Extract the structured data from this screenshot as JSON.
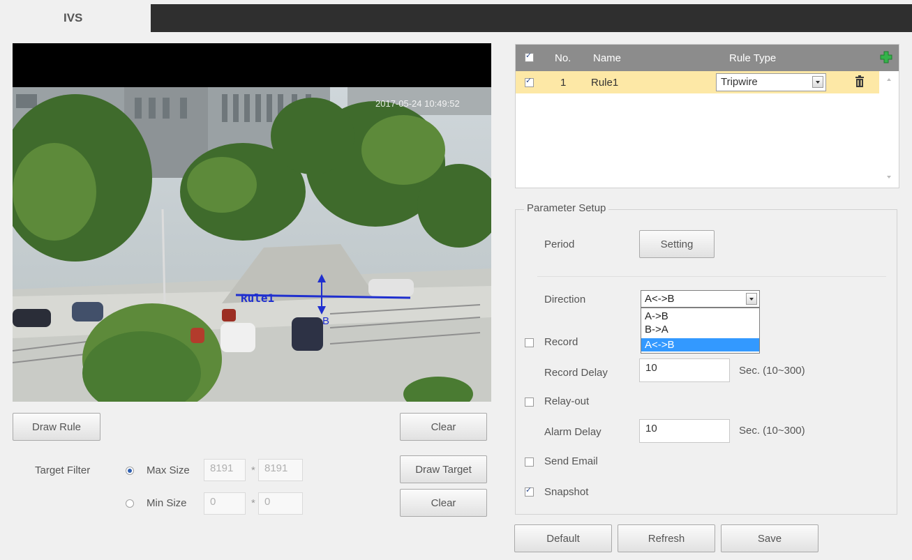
{
  "tab": {
    "label": "IVS"
  },
  "video": {
    "timestamp": "2017-05-24 10:49:52",
    "rule_label": "Rule1",
    "point_b": "B"
  },
  "left_controls": {
    "draw_rule": "Draw Rule",
    "clear1": "Clear",
    "target_filter_label": "Target Filter",
    "max_size_label": "Max Size",
    "max_w": "8191",
    "max_h": "8191",
    "min_size_label": "Min Size",
    "min_w": "0",
    "min_h": "0",
    "times": "*",
    "draw_target": "Draw Target",
    "clear2": "Clear"
  },
  "rule_table": {
    "headers": {
      "no": "No.",
      "name": "Name",
      "rule_type": "Rule Type"
    },
    "rows": [
      {
        "no": "1",
        "name": "Rule1",
        "rule_type": "Tripwire"
      }
    ]
  },
  "param": {
    "legend": "Parameter Setup",
    "period_label": "Period",
    "setting_button": "Setting",
    "direction_label": "Direction",
    "direction_value": "A<->B",
    "direction_options": [
      "A->B",
      "B->A",
      "A<->B"
    ],
    "record_label": "Record",
    "record_delay_label": "Record Delay",
    "record_delay_value": "10",
    "record_delay_unit": "Sec. (10~300)",
    "relay_out_label": "Relay-out",
    "alarm_delay_label": "Alarm Delay",
    "alarm_delay_value": "10",
    "alarm_delay_unit": "Sec. (10~300)",
    "send_email_label": "Send Email",
    "snapshot_label": "Snapshot"
  },
  "footer": {
    "default": "Default",
    "refresh": "Refresh",
    "save": "Save"
  },
  "colors": {
    "selected_row": "#fde8a6",
    "dropdown_highlight": "#3399ff",
    "table_header": "#8c8c8c",
    "add_icon": "#34b34a"
  }
}
